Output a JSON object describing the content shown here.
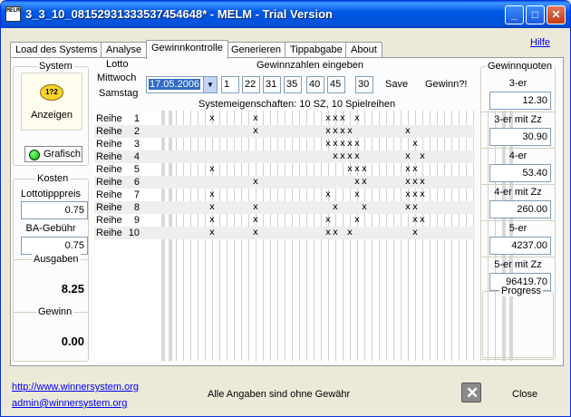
{
  "window": {
    "title": "3_3_10_08152931333537454648* - MELM - Trial Version",
    "icon_text": "MELM",
    "minimize": "_",
    "maximize": "□",
    "close": "✕"
  },
  "tabs": [
    "Load des Systems",
    "Analyse",
    "Gewinnkontrolle",
    "Generieren",
    "Tippabgabe",
    "About"
  ],
  "active_tab": "Gewinnkontrolle",
  "help_link": "Hilfe",
  "system": {
    "label": "System",
    "show_button": "Anzeigen",
    "grafisch_label": "Grafisch"
  },
  "kosten": {
    "label": "Kosten",
    "lottotipppreis_label": "Lottotipppreis",
    "lottotipppreis_value": "0.75",
    "ba_gebuehr_label": "BA-Gebühr",
    "ba_gebuehr_value": "0.75",
    "ausgaben_label": "Ausgaben",
    "ausgaben_value": "8.25",
    "gewinn_label": "Gewinn",
    "gewinn_value": "0.00"
  },
  "lotto": {
    "label": "Lotto",
    "day1": "Mittwoch",
    "day2": "Samstag",
    "date": "17.05.2006",
    "gewinnzahlen_label": "Gewinnzahlen eingeben",
    "numbers": [
      "1",
      "22",
      "31",
      "35",
      "40",
      "45"
    ],
    "zusatzzahl": "30",
    "save_button": "Save",
    "gewinn_button": "Gewinn?!",
    "system_info": "Systemeigenschaften: 10 SZ, 10 Spielreihen"
  },
  "reihen": [
    {
      "name": "Reihe",
      "num": "1"
    },
    {
      "name": "Reihe",
      "num": "2"
    },
    {
      "name": "Reihe",
      "num": "3"
    },
    {
      "name": "Reihe",
      "num": "4"
    },
    {
      "name": "Reihe",
      "num": "5"
    },
    {
      "name": "Reihe",
      "num": "6"
    },
    {
      "name": "Reihe",
      "num": "7"
    },
    {
      "name": "Reihe",
      "num": "8"
    },
    {
      "name": "Reihe",
      "num": "9"
    },
    {
      "name": "Reihe",
      "num": "10"
    }
  ],
  "grid_marks": [
    [
      6,
      12,
      22,
      23,
      24,
      26
    ],
    [
      12,
      22,
      23,
      24,
      25,
      33
    ],
    [
      22,
      23,
      24,
      25,
      26,
      34
    ],
    [
      23,
      24,
      25,
      26,
      33,
      35
    ],
    [
      6,
      25,
      26,
      27,
      33,
      34
    ],
    [
      12,
      26,
      27,
      33,
      34,
      35
    ],
    [
      6,
      22,
      26,
      33,
      34,
      35
    ],
    [
      6,
      12,
      23,
      27,
      33,
      34
    ],
    [
      6,
      12,
      22,
      26,
      34,
      35
    ],
    [
      6,
      12,
      22,
      23,
      25,
      34
    ]
  ],
  "quoten": {
    "label": "Gewinnquoten",
    "items": [
      {
        "label": "3-er",
        "value": "12.30"
      },
      {
        "label": "3-er mit Zz",
        "value": "30.90"
      },
      {
        "label": "4-er",
        "value": "53.40"
      },
      {
        "label": "4-er mit Zz",
        "value": "260.00"
      },
      {
        "label": "5-er",
        "value": "4237.00"
      },
      {
        "label": "5-er mit Zz",
        "value": "96419.70"
      }
    ],
    "progress_label": "Progress"
  },
  "footer": {
    "url": "http://www.winnersystem.org",
    "email": "admin@winnersystem.org",
    "disclaimer": "Alle Angaben sind ohne Gewähr",
    "close_label": "Close"
  }
}
